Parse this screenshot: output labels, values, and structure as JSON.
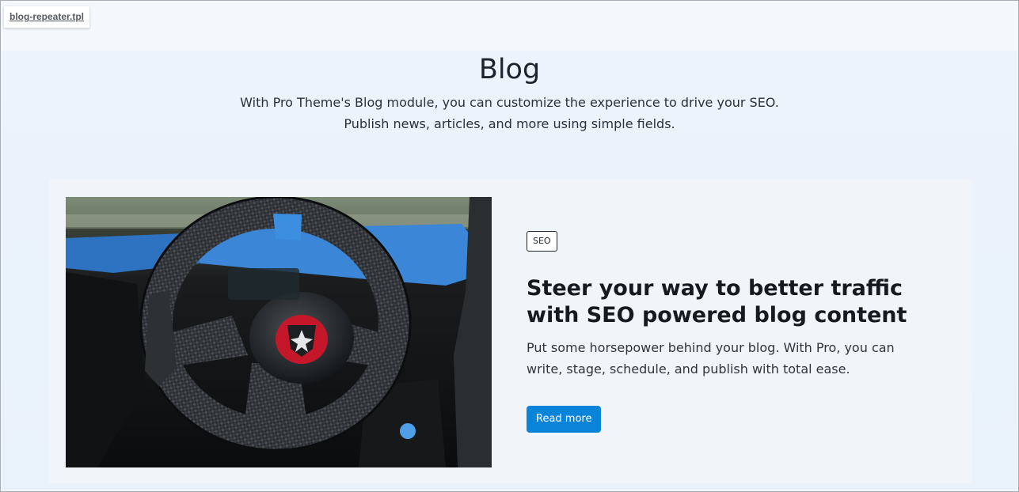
{
  "file_tag": {
    "label": "blog-repeater.tpl"
  },
  "header": {
    "title": "Blog",
    "intro_line1": "With Pro Theme's Blog module, you can customize the experience to drive your SEO.",
    "intro_line2": "Publish news, articles, and more using simple fields."
  },
  "post": {
    "tag": "SEO",
    "title": "Steer your way to better traffic with SEO powered blog content",
    "summary": "Put some horsepower behind your blog. With Pro, you can write, stage, schedule, and publish with total ease.",
    "button_label": "Read more",
    "image_alt": "steering-wheel-photo"
  },
  "colors": {
    "accent": "#0a84d8",
    "page_bg": "#eaf2fb",
    "card_bg": "#f1f5f9",
    "text_dark": "#141a20"
  }
}
